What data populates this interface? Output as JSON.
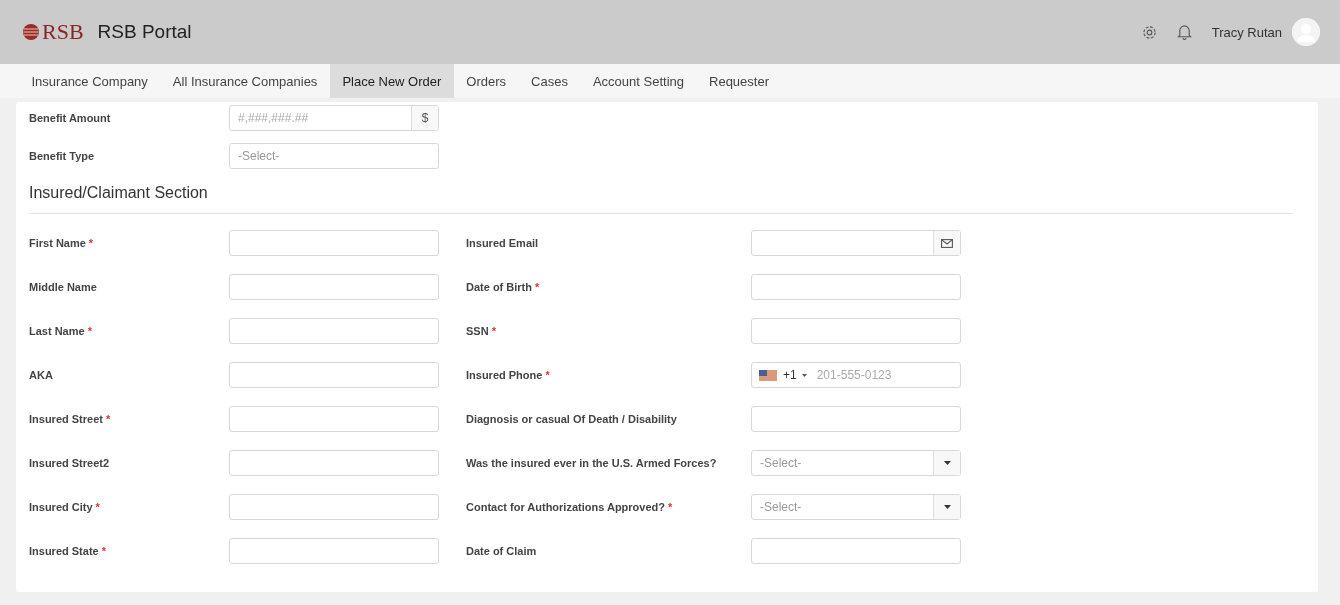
{
  "header": {
    "logo": "RSB",
    "title": "RSB Portal",
    "user": "Tracy Rutan"
  },
  "tabs": [
    {
      "label": "Insurance Company",
      "selected": false
    },
    {
      "label": "All Insurance Companies",
      "selected": false
    },
    {
      "label": "Place New Order",
      "selected": true
    },
    {
      "label": "Orders",
      "selected": false
    },
    {
      "label": "Cases",
      "selected": false
    },
    {
      "label": "Account Setting",
      "selected": false
    },
    {
      "label": "Requester",
      "selected": false
    }
  ],
  "required_mark": "*",
  "benefit_fields": [
    {
      "label": "Benefit Amount",
      "required": false,
      "kind": "currency",
      "placeholder": "#,###,###.##",
      "addon": "$"
    },
    {
      "label": "Benefit Type",
      "required": false,
      "kind": "select",
      "placeholder": "-Select-"
    }
  ],
  "section_title": "Insured/Claimant Section",
  "rows": [
    {
      "left": {
        "label": "First Name",
        "required": true,
        "kind": "text"
      },
      "right": {
        "label": "Insured Email",
        "required": false,
        "kind": "email"
      }
    },
    {
      "left": {
        "label": "Middle Name",
        "required": false,
        "kind": "text"
      },
      "right": {
        "label": "Date of Birth",
        "required": true,
        "kind": "text"
      }
    },
    {
      "left": {
        "label": "Last Name",
        "required": true,
        "kind": "text"
      },
      "right": {
        "label": "SSN",
        "required": true,
        "kind": "text"
      }
    },
    {
      "left": {
        "label": "AKA",
        "required": false,
        "kind": "text"
      },
      "right": {
        "label": "Insured Phone",
        "required": true,
        "kind": "phone",
        "code": "+1",
        "placeholder": "201-555-0123"
      }
    },
    {
      "left": {
        "label": "Insured Street",
        "required": true,
        "kind": "text"
      },
      "right": {
        "label": "Diagnosis or casual Of Death / Disability",
        "required": false,
        "kind": "text"
      }
    },
    {
      "left": {
        "label": "Insured Street2",
        "required": false,
        "kind": "text"
      },
      "right": {
        "label": "Was the insured ever in the U.S. Armed Forces?",
        "required": false,
        "kind": "dropdown",
        "placeholder": "-Select-"
      }
    },
    {
      "left": {
        "label": "Insured City",
        "required": true,
        "kind": "text"
      },
      "right": {
        "label": "Contact for Authorizations Approved?",
        "required": true,
        "kind": "dropdown",
        "placeholder": "-Select-"
      }
    },
    {
      "left": {
        "label": "Insured State",
        "required": true,
        "kind": "text"
      },
      "right": {
        "label": "Date of Claim",
        "required": false,
        "kind": "text"
      }
    }
  ]
}
